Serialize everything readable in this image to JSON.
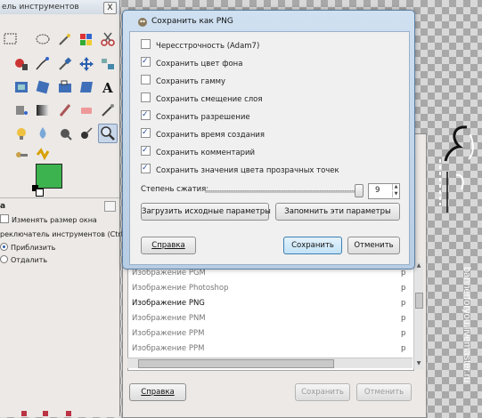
{
  "toolbox": {
    "title": "ель инструментов",
    "close": "X",
    "options_title": "а",
    "opt1": "Изменять размер окна",
    "opt2": "реключатель инструментов  (Ctrl)",
    "radio_zoom_in": "Приблизить",
    "radio_zoom_out": "Отдалить",
    "fg_color": "#3db34f"
  },
  "dialog": {
    "title": "Сохранить как PNG",
    "options": [
      {
        "label": "Чересстрочность (Adam7)",
        "checked": false
      },
      {
        "label": "Сохранить цвет фона",
        "checked": true
      },
      {
        "label": "Сохранить гамму",
        "checked": false
      },
      {
        "label": "Сохранить смещение слоя",
        "checked": false
      },
      {
        "label": "Сохранить разрешение",
        "checked": true
      },
      {
        "label": "Сохранить время создания",
        "checked": true
      },
      {
        "label": "Сохранить комментарий",
        "checked": true
      },
      {
        "label": "Сохранить значения цвета прозрачных точек",
        "checked": true
      }
    ],
    "compression_label": "Степень сжатия:",
    "compression_value": "9",
    "load_defaults": "Загрузить исходные параметры",
    "save_defaults": "Запомнить эти параметры",
    "help": "Справка",
    "save": "Сохранить",
    "cancel": "Отменить"
  },
  "back_dialog": {
    "file_types": [
      {
        "name": "Изображение PGM",
        "ext": "p",
        "selected": false
      },
      {
        "name": "Изображение Photoshop",
        "ext": "p",
        "selected": false
      },
      {
        "name": "Изображение PNG",
        "ext": "p",
        "selected": true
      },
      {
        "name": "Изображение PNM",
        "ext": "p",
        "selected": false
      },
      {
        "name": "Изображение PPM",
        "ext": "p",
        "selected": false
      },
      {
        "name": "Изображение PPM",
        "ext": "p",
        "selected": false
      }
    ],
    "help": "Справка",
    "save": "Сохранить",
    "cancel": "Отменить"
  },
  "watermark": "bannerforyou.livemaster.ru"
}
